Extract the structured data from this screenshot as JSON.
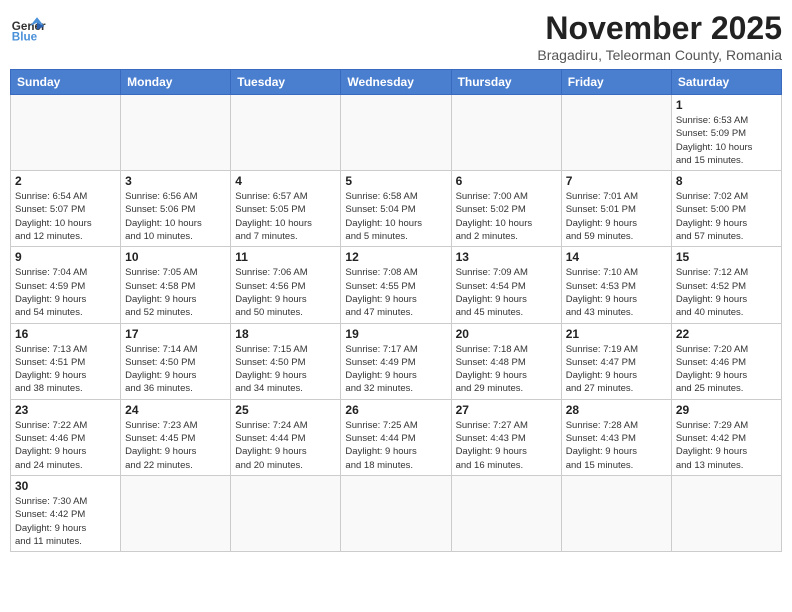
{
  "header": {
    "logo_general": "General",
    "logo_blue": "Blue",
    "month_title": "November 2025",
    "subtitle": "Bragadiru, Teleorman County, Romania"
  },
  "days_of_week": [
    "Sunday",
    "Monday",
    "Tuesday",
    "Wednesday",
    "Thursday",
    "Friday",
    "Saturday"
  ],
  "weeks": [
    [
      {
        "day": "",
        "info": ""
      },
      {
        "day": "",
        "info": ""
      },
      {
        "day": "",
        "info": ""
      },
      {
        "day": "",
        "info": ""
      },
      {
        "day": "",
        "info": ""
      },
      {
        "day": "",
        "info": ""
      },
      {
        "day": "1",
        "info": "Sunrise: 6:53 AM\nSunset: 5:09 PM\nDaylight: 10 hours\nand 15 minutes."
      }
    ],
    [
      {
        "day": "2",
        "info": "Sunrise: 6:54 AM\nSunset: 5:07 PM\nDaylight: 10 hours\nand 12 minutes."
      },
      {
        "day": "3",
        "info": "Sunrise: 6:56 AM\nSunset: 5:06 PM\nDaylight: 10 hours\nand 10 minutes."
      },
      {
        "day": "4",
        "info": "Sunrise: 6:57 AM\nSunset: 5:05 PM\nDaylight: 10 hours\nand 7 minutes."
      },
      {
        "day": "5",
        "info": "Sunrise: 6:58 AM\nSunset: 5:04 PM\nDaylight: 10 hours\nand 5 minutes."
      },
      {
        "day": "6",
        "info": "Sunrise: 7:00 AM\nSunset: 5:02 PM\nDaylight: 10 hours\nand 2 minutes."
      },
      {
        "day": "7",
        "info": "Sunrise: 7:01 AM\nSunset: 5:01 PM\nDaylight: 9 hours\nand 59 minutes."
      },
      {
        "day": "8",
        "info": "Sunrise: 7:02 AM\nSunset: 5:00 PM\nDaylight: 9 hours\nand 57 minutes."
      }
    ],
    [
      {
        "day": "9",
        "info": "Sunrise: 7:04 AM\nSunset: 4:59 PM\nDaylight: 9 hours\nand 54 minutes."
      },
      {
        "day": "10",
        "info": "Sunrise: 7:05 AM\nSunset: 4:58 PM\nDaylight: 9 hours\nand 52 minutes."
      },
      {
        "day": "11",
        "info": "Sunrise: 7:06 AM\nSunset: 4:56 PM\nDaylight: 9 hours\nand 50 minutes."
      },
      {
        "day": "12",
        "info": "Sunrise: 7:08 AM\nSunset: 4:55 PM\nDaylight: 9 hours\nand 47 minutes."
      },
      {
        "day": "13",
        "info": "Sunrise: 7:09 AM\nSunset: 4:54 PM\nDaylight: 9 hours\nand 45 minutes."
      },
      {
        "day": "14",
        "info": "Sunrise: 7:10 AM\nSunset: 4:53 PM\nDaylight: 9 hours\nand 43 minutes."
      },
      {
        "day": "15",
        "info": "Sunrise: 7:12 AM\nSunset: 4:52 PM\nDaylight: 9 hours\nand 40 minutes."
      }
    ],
    [
      {
        "day": "16",
        "info": "Sunrise: 7:13 AM\nSunset: 4:51 PM\nDaylight: 9 hours\nand 38 minutes."
      },
      {
        "day": "17",
        "info": "Sunrise: 7:14 AM\nSunset: 4:50 PM\nDaylight: 9 hours\nand 36 minutes."
      },
      {
        "day": "18",
        "info": "Sunrise: 7:15 AM\nSunset: 4:50 PM\nDaylight: 9 hours\nand 34 minutes."
      },
      {
        "day": "19",
        "info": "Sunrise: 7:17 AM\nSunset: 4:49 PM\nDaylight: 9 hours\nand 32 minutes."
      },
      {
        "day": "20",
        "info": "Sunrise: 7:18 AM\nSunset: 4:48 PM\nDaylight: 9 hours\nand 29 minutes."
      },
      {
        "day": "21",
        "info": "Sunrise: 7:19 AM\nSunset: 4:47 PM\nDaylight: 9 hours\nand 27 minutes."
      },
      {
        "day": "22",
        "info": "Sunrise: 7:20 AM\nSunset: 4:46 PM\nDaylight: 9 hours\nand 25 minutes."
      }
    ],
    [
      {
        "day": "23",
        "info": "Sunrise: 7:22 AM\nSunset: 4:46 PM\nDaylight: 9 hours\nand 24 minutes."
      },
      {
        "day": "24",
        "info": "Sunrise: 7:23 AM\nSunset: 4:45 PM\nDaylight: 9 hours\nand 22 minutes."
      },
      {
        "day": "25",
        "info": "Sunrise: 7:24 AM\nSunset: 4:44 PM\nDaylight: 9 hours\nand 20 minutes."
      },
      {
        "day": "26",
        "info": "Sunrise: 7:25 AM\nSunset: 4:44 PM\nDaylight: 9 hours\nand 18 minutes."
      },
      {
        "day": "27",
        "info": "Sunrise: 7:27 AM\nSunset: 4:43 PM\nDaylight: 9 hours\nand 16 minutes."
      },
      {
        "day": "28",
        "info": "Sunrise: 7:28 AM\nSunset: 4:43 PM\nDaylight: 9 hours\nand 15 minutes."
      },
      {
        "day": "29",
        "info": "Sunrise: 7:29 AM\nSunset: 4:42 PM\nDaylight: 9 hours\nand 13 minutes."
      }
    ],
    [
      {
        "day": "30",
        "info": "Sunrise: 7:30 AM\nSunset: 4:42 PM\nDaylight: 9 hours\nand 11 minutes."
      },
      {
        "day": "",
        "info": ""
      },
      {
        "day": "",
        "info": ""
      },
      {
        "day": "",
        "info": ""
      },
      {
        "day": "",
        "info": ""
      },
      {
        "day": "",
        "info": ""
      },
      {
        "day": "",
        "info": ""
      }
    ]
  ]
}
